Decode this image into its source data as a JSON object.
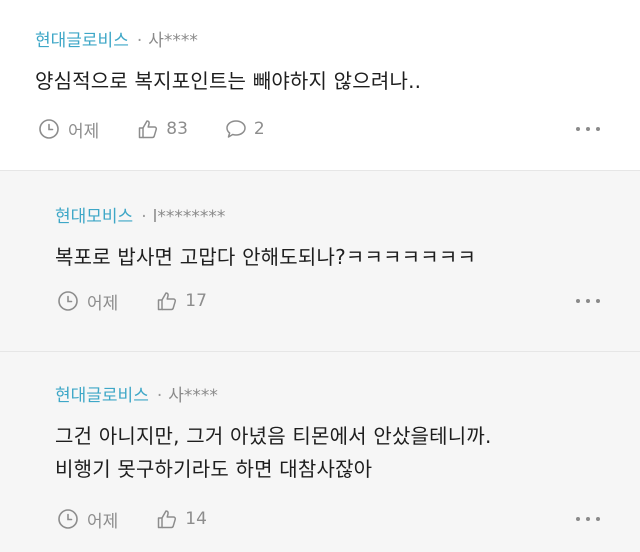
{
  "comments": [
    {
      "author": "현대글로비스",
      "separator": "·",
      "user_id": "사****",
      "text_lines": [
        "양심적으로 복지포인트는 빼야하지 않으려나.."
      ],
      "time_label": "어제",
      "like_count": "83",
      "reply_count": "2"
    },
    {
      "author": "현대모비스",
      "separator": "·",
      "user_id": "l********",
      "text_lines": [
        "복포로 밥사면 고맙다 안해도되나?ㅋㅋㅋㅋㅋㅋㅋ"
      ],
      "time_label": "어제",
      "like_count": "17"
    },
    {
      "author": "현대글로비스",
      "separator": "·",
      "user_id": "사****",
      "text_lines": [
        "그건 아니지만, 그거 아녔음 티몬에서 안샀을테니까.",
        "비행기 못구하기라도 하면 대참사잖아"
      ],
      "time_label": "어제",
      "like_count": "14"
    }
  ],
  "icons": {
    "time": "clock-icon",
    "like": "thumbs-up-icon",
    "reply": "speech-bubble-icon",
    "more": "more-options-icon"
  },
  "colors": {
    "author": "#3ea7c7",
    "meta_gray": "#8d8d8d",
    "reply_background": "#f6f6f6"
  }
}
